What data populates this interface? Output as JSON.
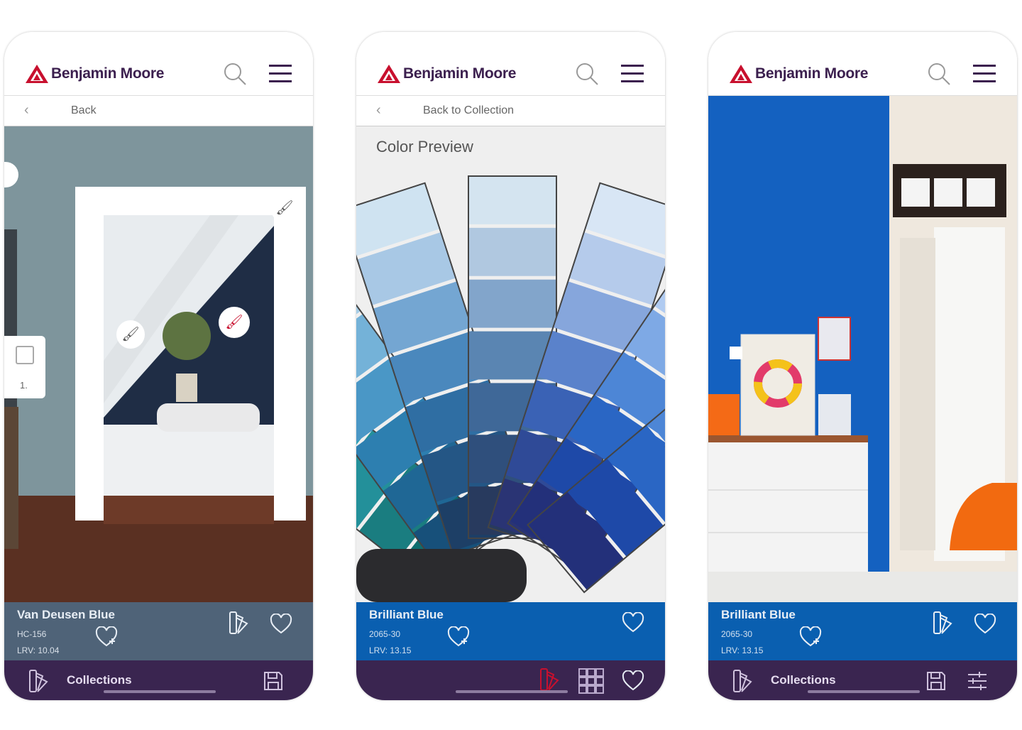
{
  "brand": {
    "name": "Benjamin Moore",
    "logo_color": "#c8102e"
  },
  "colors": {
    "nav_bg": "#3a2550",
    "accent": "#c8102e"
  },
  "screens": [
    {
      "back_label": "Back",
      "color": {
        "name": "Van Deusen Blue",
        "code": "HC-156",
        "lrv": "LRV: 10.04",
        "bg": "#4f6378"
      },
      "nav": {
        "collections_label": "Collections"
      },
      "wall_badge": "1."
    },
    {
      "back_label": "Back to Collection",
      "title": "Color Preview",
      "color": {
        "name": "Brilliant Blue",
        "code": "2065-30",
        "lrv": "LRV: 13.15",
        "bg": "#0a5fb0"
      }
    },
    {
      "color": {
        "name": "Brilliant Blue",
        "code": "2065-30",
        "lrv": "LRV: 13.15",
        "bg": "#0a5fb0"
      },
      "nav": {
        "collections_label": "Collections"
      }
    }
  ],
  "icons": [
    "search-icon",
    "menu-icon",
    "chevron-left-icon",
    "paint-brush-icon",
    "fan-deck-icon",
    "heart-icon",
    "heart-plus-icon",
    "save-icon",
    "grid-icon",
    "sliders-icon",
    "layers-icon"
  ]
}
